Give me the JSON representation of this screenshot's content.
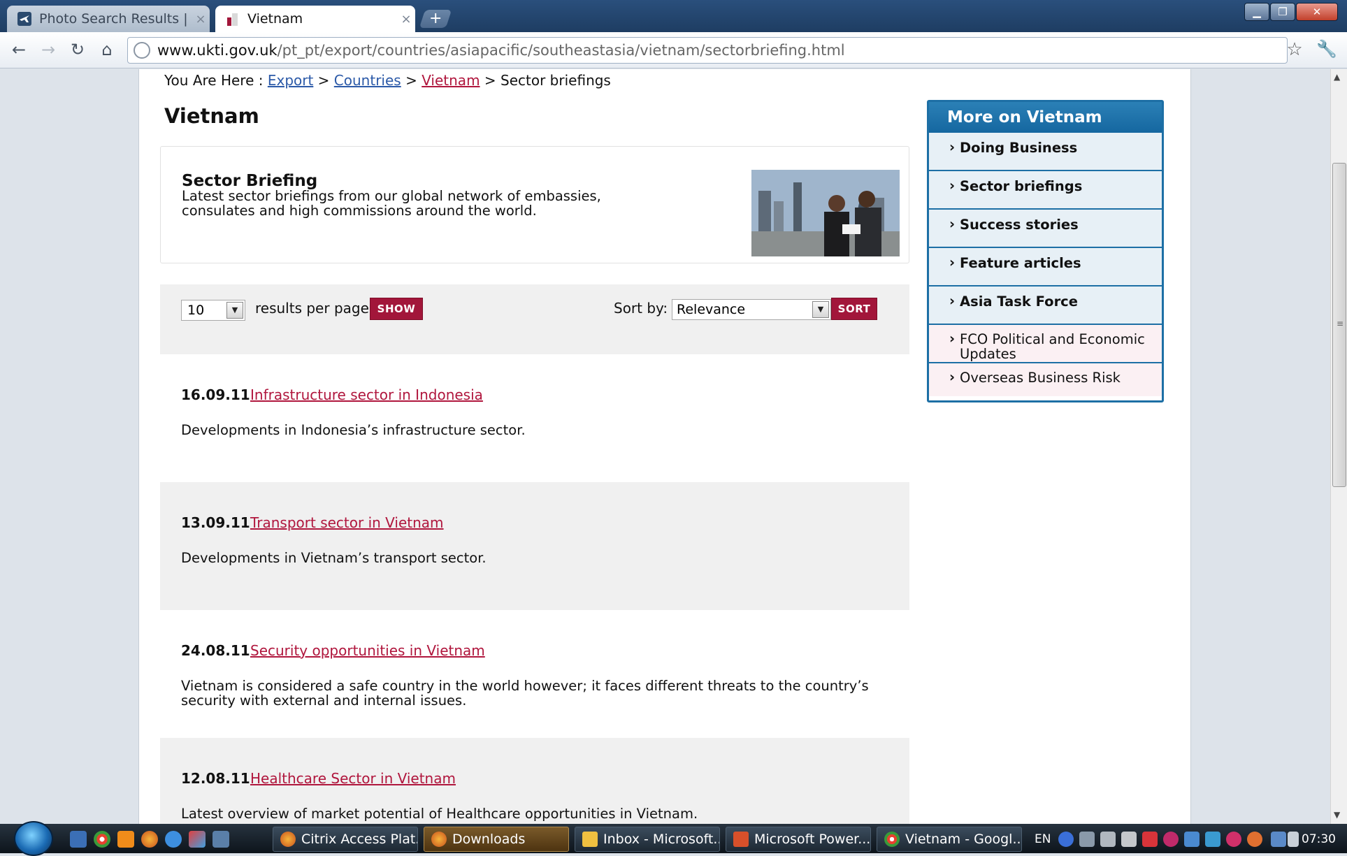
{
  "browser": {
    "tabs": [
      {
        "title": "Photo Search Results | Airlin",
        "icon": "airplane-icon"
      },
      {
        "title": "Vietnam",
        "icon": "ukti-icon"
      }
    ],
    "new_tab_label": "+",
    "url_domain": "www.ukti.gov.uk",
    "url_path": "/pt_pt/export/countries/asiapacific/southeastasia/vietnam/sectorbriefing.html"
  },
  "page": {
    "breadcrumb": {
      "prefix": "You Are Here :",
      "items": [
        "Export",
        "Countries",
        "Vietnam"
      ],
      "sep": ">",
      "current": "Sector briefings"
    },
    "title": "Vietnam",
    "intro": {
      "heading": "Sector Briefing",
      "text": "Latest sector briefings from our global network of embassies, consulates and high commissions around the world."
    },
    "controls": {
      "per_page_value": "10",
      "per_page_label": "results per page",
      "show_label": "SHOW",
      "sort_label": "Sort by:",
      "sort_value": "Relevance",
      "sort_button_label": "SORT"
    },
    "results": [
      {
        "date": "16.09.11",
        "title": "Infrastructure sector in Indonesia",
        "desc": "Developments in Indonesia’s infrastructure sector."
      },
      {
        "date": "13.09.11",
        "title": "Transport sector in Vietnam",
        "desc": "Developments in Vietnam’s transport sector."
      },
      {
        "date": "24.08.11",
        "title": "Security opportunities in Vietnam",
        "desc": "Vietnam is considered a safe country in the world however; it faces different threats to the country’s security with external and internal issues."
      },
      {
        "date": "12.08.11",
        "title": "Healthcare Sector in Vietnam",
        "desc": "Latest overview of market potential of Healthcare opportunities in Vietnam."
      }
    ],
    "sidebar": {
      "title": "More on Vietnam",
      "items": [
        "Doing Business",
        "Sector briefings",
        "Success stories",
        "Feature articles",
        "Asia Task Force"
      ],
      "extra_items": [
        "FCO Political and Economic Updates",
        "Overseas Business Risk"
      ],
      "chevron": "›"
    }
  },
  "taskbar": {
    "tasks": [
      {
        "label": "Citrix Access Plat...",
        "active": false
      },
      {
        "label": "Downloads",
        "active": true
      },
      {
        "label": "Inbox - Microsoft...",
        "active": false
      },
      {
        "label": "Microsoft Power...",
        "active": false
      },
      {
        "label": "Vietnam - Googl...",
        "active": false
      }
    ],
    "lang": "EN",
    "clock": "07:30"
  },
  "colors": {
    "accent_red": "#a2163a",
    "link_red": "#b0163d",
    "link_blue": "#2c5aa8",
    "panel_blue": "#1d6fa5"
  }
}
